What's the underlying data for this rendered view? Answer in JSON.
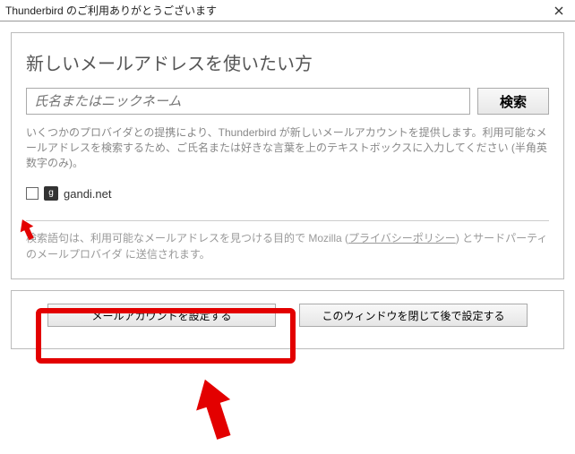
{
  "titlebar": {
    "title": "Thunderbird のご利用ありがとうございます"
  },
  "main": {
    "heading": "新しいメールアドレスを使いたい方",
    "search": {
      "placeholder": "氏名またはニックネーム",
      "button": "検索"
    },
    "description": "いくつかのプロバイダとの提携により、Thunderbird が新しいメールアカウントを提供します。利用可能なメールアドレスを検索するため、ご氏名または好きな言葉を上のテキストボックスに入力してください (半角英数字のみ)。",
    "provider": {
      "label": "gandi.net",
      "icon_letter": "g"
    },
    "note_pre": "検索語句は、利用可能なメールアドレスを見つける目的で Mozilla (",
    "note_link": "プライバシーポリシー",
    "note_post": ") とサードパーティのメールプロバイダ に送信されます。"
  },
  "buttons": {
    "configure": "メールアカウントを設定する",
    "later": "このウィンドウを閉じて後で設定する"
  }
}
